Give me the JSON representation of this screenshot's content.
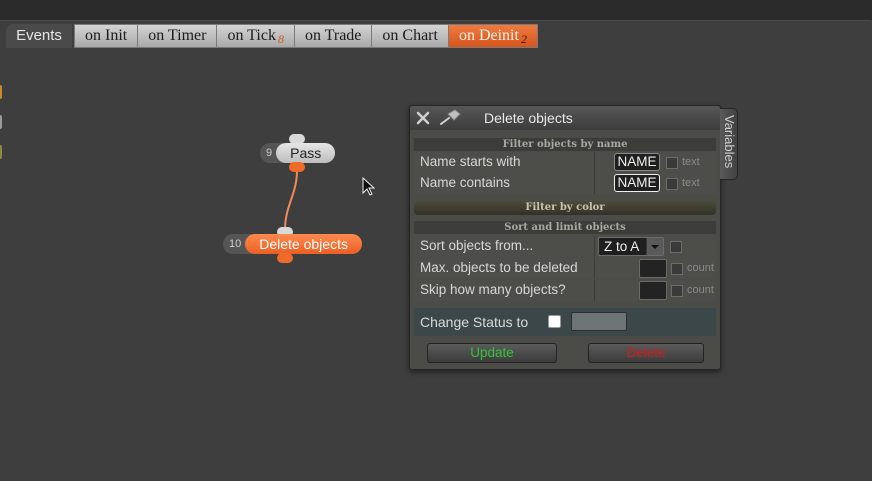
{
  "tabs": {
    "label": "Events",
    "items": [
      {
        "label": "on Init",
        "badge": ""
      },
      {
        "label": "on Timer",
        "badge": ""
      },
      {
        "label": "on Tick",
        "badge": "8"
      },
      {
        "label": "on Trade",
        "badge": ""
      },
      {
        "label": "on Chart",
        "badge": ""
      },
      {
        "label": "on Deinit",
        "badge": "2",
        "active": true
      }
    ]
  },
  "nodes": [
    {
      "id": "9",
      "name": "Pass"
    },
    {
      "id": "10",
      "name": "Delete objects"
    }
  ],
  "dialog": {
    "title": "Delete objects",
    "side_tab": "Variables",
    "filter_name": {
      "heading": "Filter objects by name",
      "starts_with_label": "Name starts with",
      "starts_with_value": "NAME",
      "starts_with_hint": "text",
      "contains_label": "Name contains",
      "contains_value": "NAME",
      "contains_hint": "text"
    },
    "filter_color": {
      "heading": "Filter by color"
    },
    "sort_limit": {
      "heading": "Sort and limit objects",
      "sort_label": "Sort objects from...",
      "sort_value": "Z to A",
      "max_label": "Max. objects to be deleted",
      "max_hint": "count",
      "skip_label": "Skip how many objects?",
      "skip_hint": "count"
    },
    "status_label": "Change Status to",
    "update_label": "Update",
    "delete_label": "Delete"
  },
  "colors": {
    "accent_orange": "#ec5f23",
    "update_green": "#37c23d",
    "delete_red": "#d21b1b"
  }
}
